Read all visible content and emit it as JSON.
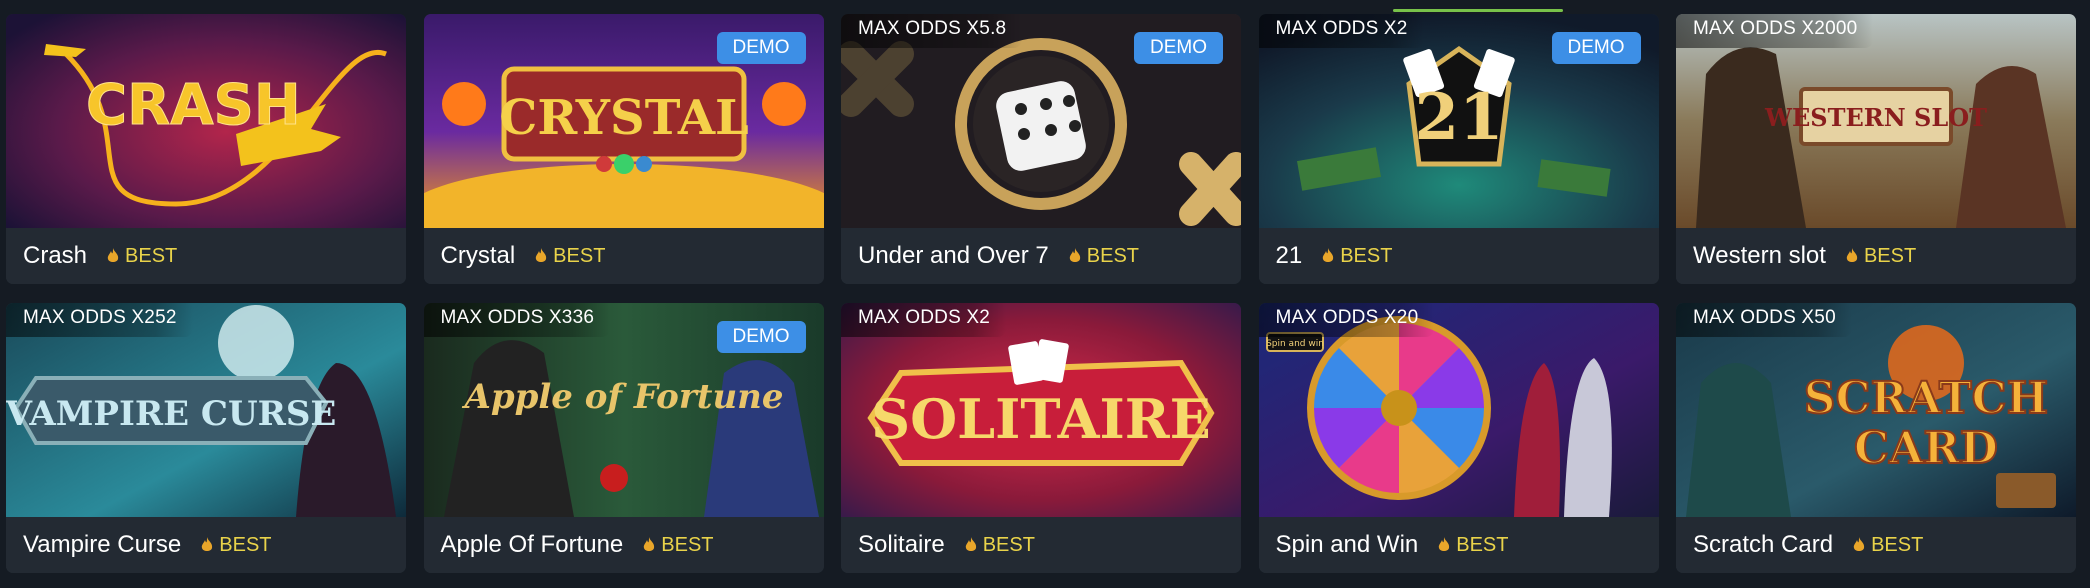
{
  "games": [
    {
      "title": "Crash",
      "badge": "BEST",
      "odds": "",
      "demo": "",
      "art": "CRASH"
    },
    {
      "title": "Crystal",
      "badge": "BEST",
      "odds": "",
      "demo": "DEMO",
      "art": "CRYSTAL"
    },
    {
      "title": "Under and Over 7",
      "badge": "BEST",
      "odds": "MAX ODDS X5.8",
      "demo": "DEMO",
      "art": ""
    },
    {
      "title": "21",
      "badge": "BEST",
      "odds": "MAX ODDS X2",
      "demo": "DEMO",
      "art": "21"
    },
    {
      "title": "Western slot",
      "badge": "BEST",
      "odds": "MAX ODDS X2000",
      "demo": "",
      "art": "WESTERN SLOT"
    },
    {
      "title": "Vampire Curse",
      "badge": "BEST",
      "odds": "MAX ODDS X252",
      "demo": "",
      "art": "VAMPIRE CURSE"
    },
    {
      "title": "Apple Of Fortune",
      "badge": "BEST",
      "odds": "MAX ODDS X336",
      "demo": "DEMO",
      "art": "Apple of Fortune"
    },
    {
      "title": "Solitaire",
      "badge": "BEST",
      "odds": "MAX ODDS X2",
      "demo": "",
      "art": "SOLITAIRE"
    },
    {
      "title": "Spin and Win",
      "badge": "BEST",
      "odds": "MAX ODDS X20",
      "demo": "",
      "art": "Spin and win"
    },
    {
      "title": "Scratch Card",
      "badge": "BEST",
      "odds": "MAX ODDS X50",
      "demo": "",
      "art": "SCRATCH CARD"
    }
  ],
  "colors": {
    "accent": "#3d8fe6",
    "best": "#e9d34a",
    "card": "#232a33",
    "background": "#151b23"
  }
}
